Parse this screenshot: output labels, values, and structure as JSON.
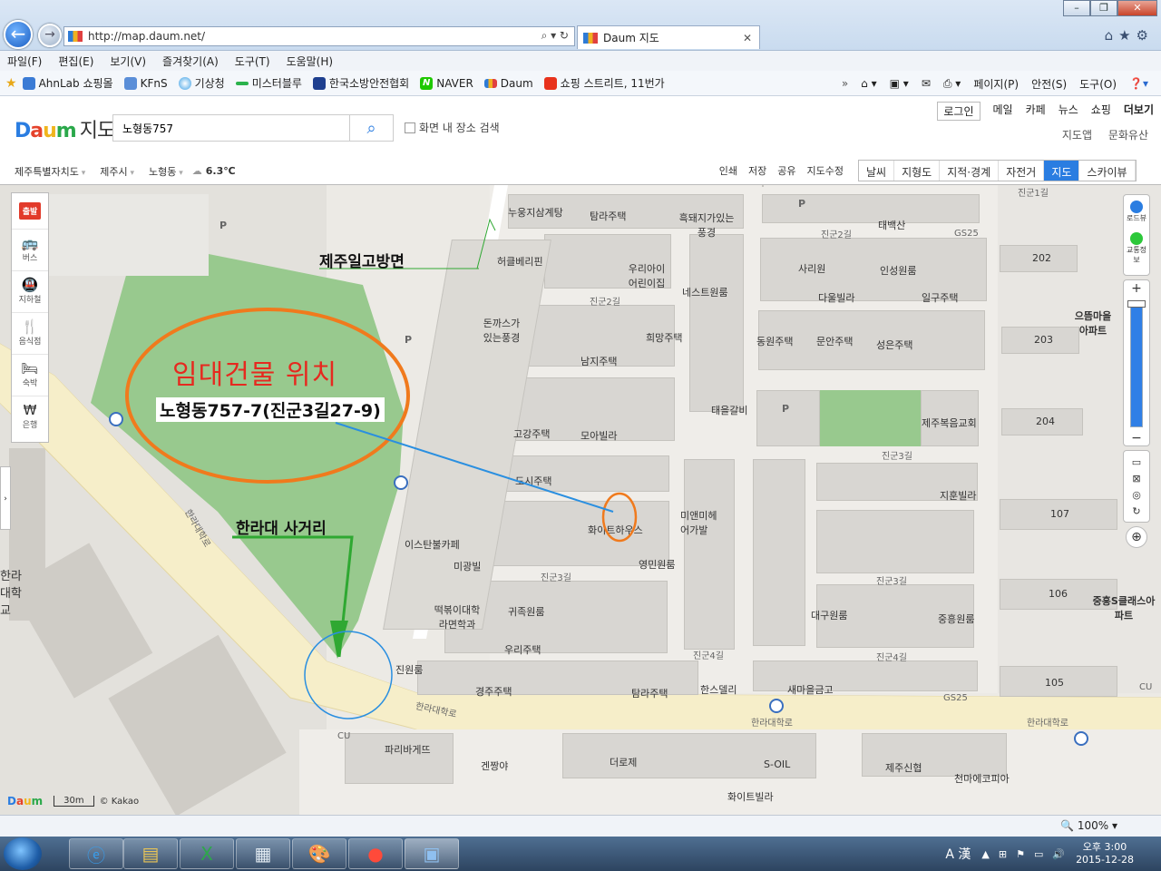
{
  "browser": {
    "address_url": "http://map.daum.net/",
    "tab_title": "Daum 지도",
    "menu": [
      "파일(F)",
      "편집(E)",
      "보기(V)",
      "즐겨찾기(A)",
      "도구(T)",
      "도움말(H)"
    ],
    "favorites": [
      "AhnLab 쇼핑몰",
      "KFnS",
      "기상청",
      "미스터블루",
      "한국소방안전협회",
      "NAVER",
      "Daum",
      "쇼핑 스트리트, 11번가"
    ],
    "command_bar": [
      "페이지(P)",
      "안전(S)",
      "도구(O)"
    ],
    "zoom": "100%"
  },
  "daum": {
    "logo_brand": "Daum",
    "logo_text": "지도",
    "search_value": "노형동757",
    "checkbox_label": "화면 내 장소 검색",
    "top_links": [
      "로그인",
      "메일",
      "카페",
      "뉴스",
      "쇼핑",
      "더보기"
    ],
    "sub_links": [
      "지도앱",
      "문화유산"
    ],
    "breadcrumb": [
      "제주특별자치도",
      "제주시",
      "노형동"
    ],
    "temperature": "6.3℃",
    "map_tools": [
      "인쇄",
      "저장",
      "공유",
      "지도수정"
    ],
    "map_types": [
      "날씨",
      "지형도",
      "지적·경계",
      "자전거",
      "지도",
      "스카이뷰"
    ],
    "active_map_type": "지도",
    "left_tools": {
      "start": "출발",
      "items": [
        {
          "label": "버스",
          "icon": "bus-icon"
        },
        {
          "label": "지하철",
          "icon": "subway-icon"
        },
        {
          "label": "음식점",
          "icon": "restaurant-icon"
        },
        {
          "label": "숙박",
          "icon": "bed-icon"
        },
        {
          "label": "은행",
          "icon": "bank-icon"
        }
      ]
    },
    "right_controls": {
      "roadview": "로드뷰",
      "traffic": "교통정보"
    },
    "scale": "30m",
    "copyright": "© Kakao"
  },
  "map_labels": {
    "pois": [
      "누웅지삼계탕",
      "탐라주택",
      "흑돼지가있는풍경",
      "태백산",
      "GS25",
      "허클베리핀",
      "우리아이어린이집",
      "네스트원룸",
      "사리원",
      "인성원룸",
      "다울빌라",
      "일구주택",
      "돈까스가있는풍경",
      "희망주택",
      "동원주택",
      "문안주택",
      "성은주택",
      "남지주택",
      "태을갈비",
      "제주복음교회",
      "고강주택",
      "모아빌라",
      "도시주택",
      "지훈빌라",
      "미앤미헤어가발",
      "화이트하우스",
      "이스탄불카페",
      "미광빌",
      "영민원룸",
      "떡볶이대학라면학과",
      "귀족원룸",
      "대구원룸",
      "중흥원룸",
      "우리주택",
      "진원룸",
      "경주주택",
      "탐라주택",
      "한스델리",
      "새마을금고",
      "GS25",
      "CU",
      "파리바게뜨",
      "겐짱야",
      "더로제",
      "S-OIL",
      "제주신협",
      "천마에코피아",
      "화이트빌라",
      "CU"
    ],
    "apartments": [
      "202",
      "203",
      "204",
      "107",
      "106",
      "105",
      "으뜸마을아파트",
      "중흥S클래스아파트"
    ],
    "roads": [
      "진군2길",
      "진군3길",
      "진군4길",
      "진군1길",
      "한라대학로",
      "한라대학로",
      "한라대학로",
      "한라대학로"
    ],
    "school": "한라대학교",
    "parking": "P"
  },
  "annotations": {
    "title": "임대건물 위치",
    "address": "노형동757-7(진군3길27-9)",
    "school_side": "제주일고방면",
    "intersection": "한라대 사거리"
  },
  "taskbar": {
    "apps": [
      "ie-icon",
      "folder-icon",
      "excel-icon",
      "calculator-icon",
      "paint-icon",
      "media-icon",
      "picture-icon"
    ],
    "ime": "A 漢",
    "clock_time": "오후 3:00",
    "clock_date": "2015-12-28"
  },
  "colors": {
    "daum_blue": "#2a7de1",
    "annotation_red": "#e6291f",
    "annotation_orange": "#f07a1d",
    "leader_line": "#2a8fe0",
    "arrow_green": "#2fa832",
    "park_green": "#98c98e"
  }
}
